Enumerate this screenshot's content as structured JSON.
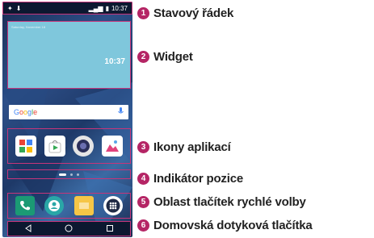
{
  "phone": {
    "status_bar": {
      "time": "10:37"
    },
    "widget": {
      "time": "10:37",
      "header": "Saturday, November 18"
    },
    "search": {
      "logo": "Google",
      "mic_icon": "mic-icon"
    },
    "apps": [
      {
        "name": "google-apps-icon",
        "icon": "grid-icon"
      },
      {
        "name": "play-store-icon",
        "icon": "store-bag-icon"
      },
      {
        "name": "camera-icon",
        "icon": "camera-icon"
      },
      {
        "name": "gallery-icon",
        "icon": "image-icon"
      }
    ],
    "quick_keys": [
      {
        "name": "phone-icon",
        "color": "#1b9a74"
      },
      {
        "name": "contacts-icon",
        "color": "#2aa7a7"
      },
      {
        "name": "messages-icon",
        "color": "#f6c646"
      },
      {
        "name": "apps-drawer-icon",
        "color": "#1f2a45"
      }
    ],
    "nav_keys": [
      "back-icon",
      "home-icon",
      "recent-apps-icon"
    ]
  },
  "callouts": [
    {
      "number": "1",
      "label": "Stavový řádek"
    },
    {
      "number": "2",
      "label": "Widget"
    },
    {
      "number": "3",
      "label": "Ikony aplikací"
    },
    {
      "number": "4",
      "label": "Indikátor pozice"
    },
    {
      "number": "5",
      "label": "Oblast tlačítek rychlé volby"
    },
    {
      "number": "6",
      "label": "Domovská dotyková tlačítka"
    }
  ],
  "colors": {
    "callout_badge": "#b52565",
    "highlight_frame": "#c6357a",
    "widget_bg": "#7fc7dc"
  }
}
